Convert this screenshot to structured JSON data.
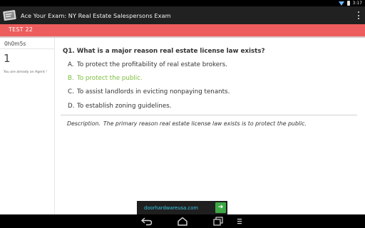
{
  "status_bar": {
    "time": "3:17",
    "icons": [
      "wifi-icon",
      "battery-icon"
    ]
  },
  "action_bar": {
    "app_title": "Ace Your Exam: NY Real Estate Salespersons Exam",
    "icon": "book-icon",
    "overflow_icon": "overflow-menu-icon"
  },
  "test_header": {
    "label": "TEST 22",
    "color": "#ee5d5d"
  },
  "sidebar": {
    "timer": "0h0m5s",
    "question_number": "1",
    "note": "You are already an Agent !"
  },
  "question": {
    "text": "Q1.  What is a major reason real estate license law exists?",
    "options": [
      {
        "letter": "A.",
        "text": "To protect the profitability of real estate brokers."
      },
      {
        "letter": "B.",
        "text": "To protect the public."
      },
      {
        "letter": "C.",
        "text": "To assist landlords in evicting nonpaying tenants."
      },
      {
        "letter": "D.",
        "text": "To establish zoning guidelines."
      }
    ],
    "correct_color": "#7cbd3a",
    "description_prefix": "Description.",
    "description": "The primary reason real estate license law exists is to protect the public."
  },
  "ad": {
    "text": "doorhardwareusa.com",
    "button_icon": "arrow-right-icon"
  },
  "nav_bar": {
    "icons": [
      "back-icon",
      "home-icon",
      "recent-apps-icon",
      "menu-icon"
    ]
  }
}
